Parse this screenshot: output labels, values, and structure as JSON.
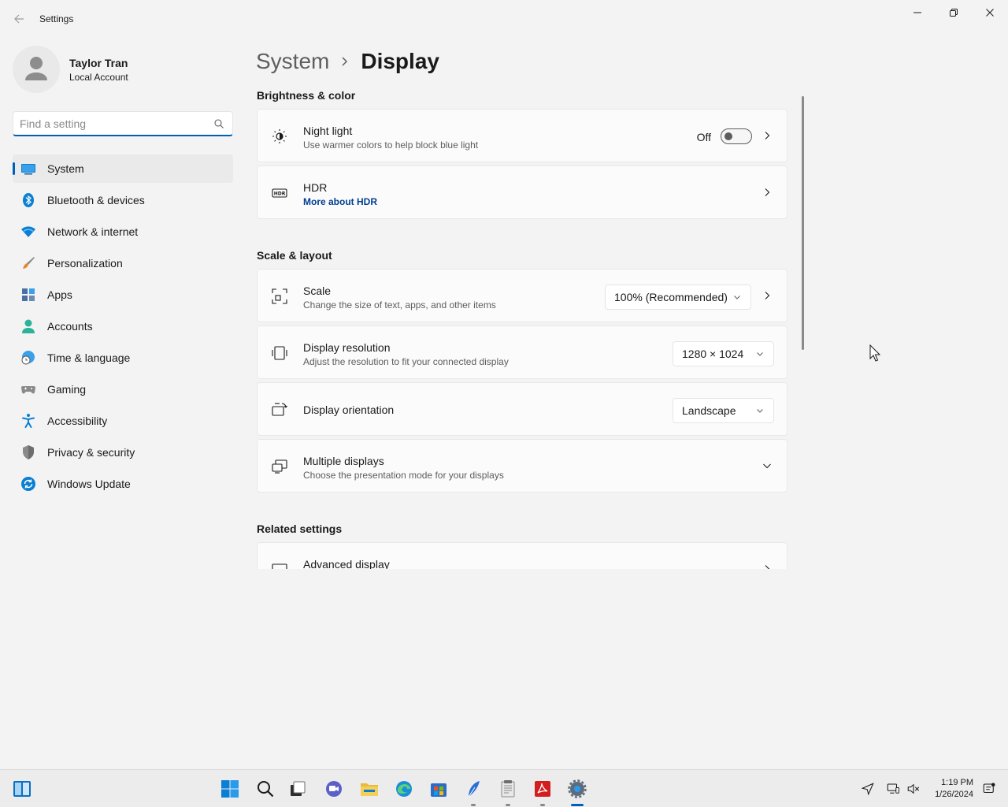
{
  "window": {
    "title": "Settings"
  },
  "user": {
    "name": "Taylor Tran",
    "account_type": "Local Account"
  },
  "search": {
    "placeholder": "Find a setting"
  },
  "sidebar": {
    "items": [
      {
        "label": "System",
        "icon": "system-icon",
        "selected": true
      },
      {
        "label": "Bluetooth & devices",
        "icon": "bluetooth-icon"
      },
      {
        "label": "Network & internet",
        "icon": "wifi-icon"
      },
      {
        "label": "Personalization",
        "icon": "brush-icon"
      },
      {
        "label": "Apps",
        "icon": "apps-icon"
      },
      {
        "label": "Accounts",
        "icon": "accounts-icon"
      },
      {
        "label": "Time & language",
        "icon": "globe-clock-icon"
      },
      {
        "label": "Gaming",
        "icon": "gamepad-icon"
      },
      {
        "label": "Accessibility",
        "icon": "accessibility-icon"
      },
      {
        "label": "Privacy & security",
        "icon": "shield-icon"
      },
      {
        "label": "Windows Update",
        "icon": "update-icon"
      }
    ]
  },
  "breadcrumb": {
    "parent": "System",
    "current": "Display"
  },
  "sections": {
    "brightness": {
      "title": "Brightness & color",
      "night_light": {
        "title": "Night light",
        "subtitle": "Use warmer colors to help block blue light",
        "toggle_state": "Off"
      },
      "hdr": {
        "title": "HDR",
        "link": "More about HDR"
      }
    },
    "scale_layout": {
      "title": "Scale & layout",
      "scale": {
        "title": "Scale",
        "subtitle": "Change the size of text, apps, and other items",
        "value": "100% (Recommended)"
      },
      "resolution": {
        "title": "Display resolution",
        "subtitle": "Adjust the resolution to fit your connected display",
        "value": "1280 × 1024"
      },
      "orientation": {
        "title": "Display orientation",
        "value": "Landscape"
      },
      "multiple": {
        "title": "Multiple displays",
        "subtitle": "Choose the presentation mode for your displays"
      }
    },
    "related": {
      "title": "Related settings",
      "advanced": {
        "title": "Advanced display"
      }
    }
  },
  "taskbar": {
    "time": "1:19 PM",
    "date": "1/26/2024"
  },
  "colors": {
    "accent": "#005fb8",
    "background": "#f3f3f3",
    "card": "#fbfbfb"
  }
}
